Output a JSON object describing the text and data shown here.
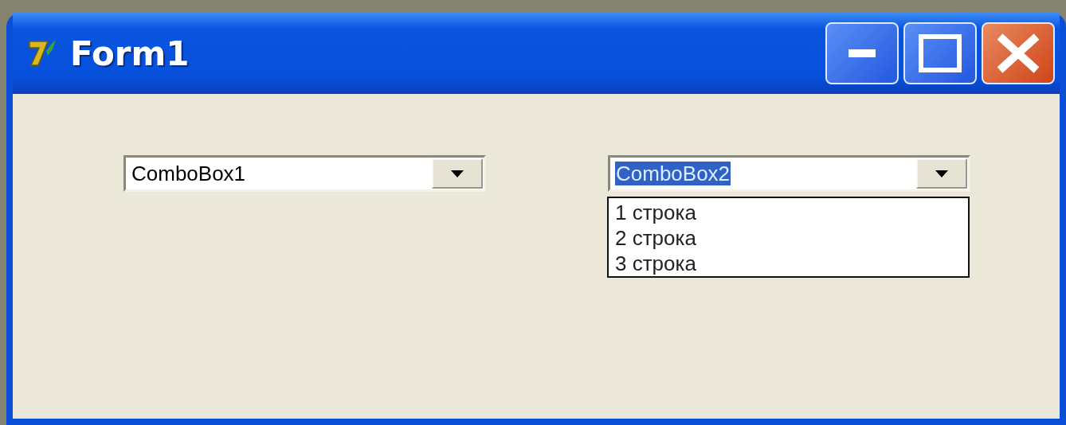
{
  "window": {
    "title": "Form1"
  },
  "combos": [
    {
      "value": "ComboBox1",
      "text_highlighted": false,
      "expanded": false
    },
    {
      "value": "ComboBox2",
      "text_highlighted": true,
      "expanded": true,
      "items": [
        {
          "label": "1 строка",
          "selected": false
        },
        {
          "label": "2 строка",
          "selected": false
        },
        {
          "label": "3 строка",
          "selected": false
        }
      ]
    }
  ]
}
